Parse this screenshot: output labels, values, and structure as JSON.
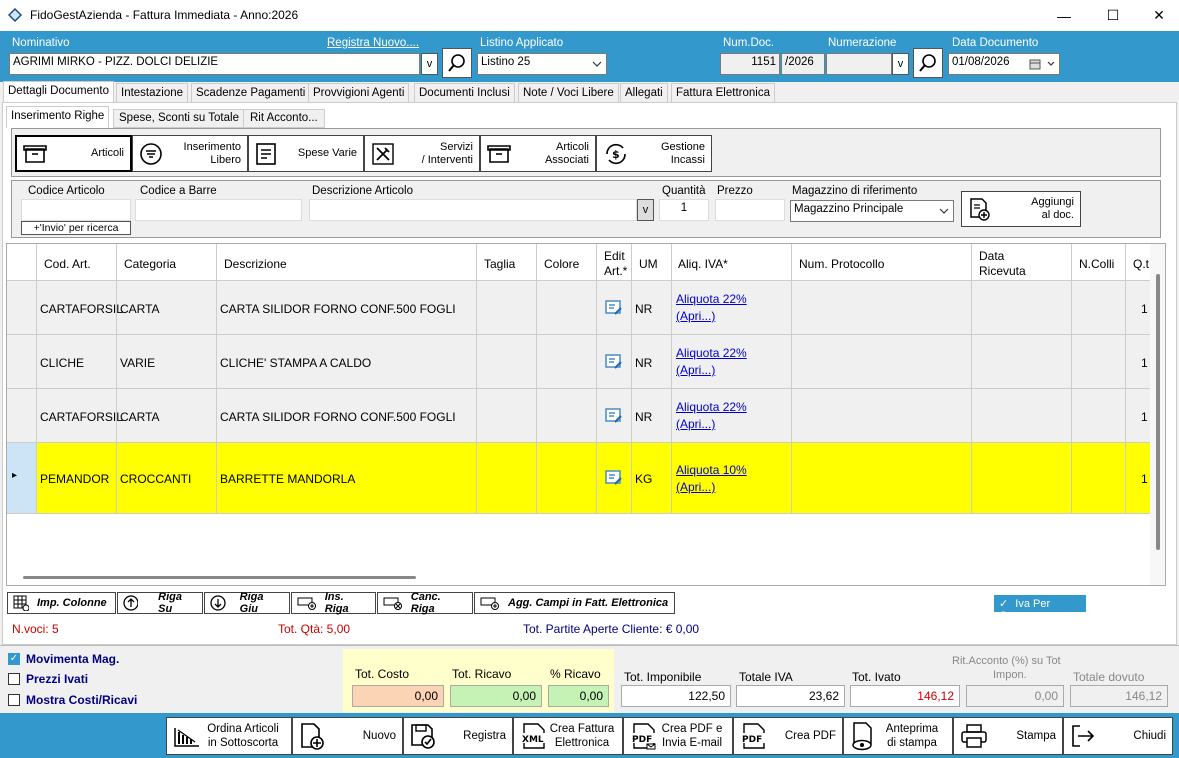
{
  "window": {
    "title": "FidoGestAzienda - Fattura Immediata - Anno:2026",
    "minimize": "—",
    "maximize": "☐",
    "close": "✕"
  },
  "header": {
    "nominativo_label": "Nominativo",
    "registra_link": "Registra Nuovo....",
    "nominativo_value": "AGRIMI MIRKO - PIZZ. DOLCI DELIZIE",
    "listino_label": "Listino Applicato",
    "listino_value": "Listino 25",
    "numdoc_label": "Num.Doc.",
    "numdoc_value": "1151",
    "numdoc_year": "/2026",
    "numerazione_label": "Numerazione",
    "numerazione_value": "",
    "data_label": "Data Documento",
    "data_value": "01/08/2026",
    "v": "v"
  },
  "tabs": [
    "Dettagli Documento",
    "Intestazione",
    "Scadenze Pagamenti",
    "Provvigioni Agenti",
    "Documenti Inclusi",
    "Note / Voci Libere",
    "Allegati",
    "Fattura Elettronica"
  ],
  "subtabs": [
    "Inserimento Righe",
    "Spese, Sconti su Totale",
    "Rit Acconto..."
  ],
  "toolbar": [
    {
      "l1": "Articoli",
      "l2": ""
    },
    {
      "l1": "Inserimento",
      "l2": "Libero"
    },
    {
      "l1": "Spese Varie",
      "l2": ""
    },
    {
      "l1": "Servizi",
      "l2": "/ Interventi"
    },
    {
      "l1": "Articoli",
      "l2": "Associati"
    },
    {
      "l1": "Gestione",
      "l2": "Incassi"
    }
  ],
  "entry": {
    "codice_label": "Codice Articolo",
    "codice_value": "",
    "invio_hint": "+'Invio' per ricerca",
    "barre_label": "Codice a Barre",
    "barre_value": "",
    "descr_label": "Descrizione Articolo",
    "descr_value": "",
    "qta_label": "Quantità",
    "qta_value": "1",
    "prezzo_label": "Prezzo",
    "prezzo_value": "",
    "mag_label": "Magazzino di riferimento",
    "mag_value": "Magazzino Principale",
    "aggiungi_l1": "Aggiungi",
    "aggiungi_l2": "al doc."
  },
  "grid": {
    "columns": {
      "cod": "Cod. Art.",
      "cat": "Categoria",
      "descr": "Descrizione",
      "taglia": "Taglia",
      "colore": "Colore",
      "edit1": "Edit",
      "edit2": "Art.*",
      "um": "UM",
      "iva": "Aliq. IVA*",
      "prot": "Num. Protocollo",
      "data1": "Data",
      "data2": "Ricevuta",
      "colli": "N.Colli",
      "qt": "Q.t"
    },
    "rows": [
      {
        "cod": "CARTAFORSIL",
        "cat": "CARTA",
        "descr": "CARTA SILIDOR FORNO CONF.500 FOGLI",
        "um": "NR",
        "iva1": "Aliquota 22% ",
        "iva2": "(Apri...)",
        "qt": "1"
      },
      {
        "cod": "CLICHE",
        "cat": "VARIE",
        "descr": "CLICHE' STAMPA A CALDO",
        "um": "NR",
        "iva1": "Aliquota 22% ",
        "iva2": "(Apri...)",
        "qt": "1"
      },
      {
        "cod": "CARTAFORSIL",
        "cat": "CARTA",
        "descr": "CARTA SILIDOR FORNO CONF.500 FOGLI",
        "um": "NR",
        "iva1": "Aliquota 22% ",
        "iva2": "(Apri...)",
        "qt": "1"
      },
      {
        "cod": "PEMANDOR",
        "cat": "CROCCANTI",
        "descr": "BARRETTE MANDORLA",
        "um": "KG",
        "iva1": "Aliquota 10% ",
        "iva2": "(Apri...)",
        "qt": "1"
      }
    ],
    "selected_marker": "▸"
  },
  "rowbuttons": [
    "Imp. Colonne",
    "Riga Su",
    "Riga Giu",
    "Ins. Riga",
    "Canc. Riga",
    "Agg. Campi in Fatt. Elettronica"
  ],
  "iva_cassa": "Iva Per Cassa",
  "status": {
    "nvoci": "N.voci: 5",
    "totqta": "Tot. Qtà: 5,00",
    "partite": "Tot. Partite Aperte Cliente: € 0,00"
  },
  "checks": {
    "movimenta": "Movimenta Mag.",
    "prezzi": "Prezzi Ivati",
    "mostra": "Mostra Costi/Ricavi"
  },
  "totals": {
    "costo_label": "Tot. Costo",
    "costo": "0,00",
    "ricavo_label": "Tot. Ricavo",
    "ricavo": "0,00",
    "pric_label": "% Ricavo",
    "pric": "0,00",
    "impon_label": "Tot. Imponibile",
    "impon": "122,50",
    "iva_label": "Totale IVA",
    "iva": "23,62",
    "ivato_label": "Tot. Ivato",
    "ivato": "146,12",
    "rit_label1": "Rit.Acconto (%) su Tot",
    "rit_label2": "Impon.",
    "rit": "0,00",
    "dovuto_label": "Totale dovuto",
    "dovuto": "146,12"
  },
  "bottom": [
    {
      "l1": "Ordina Articoli",
      "l2": "in Sottoscorta"
    },
    {
      "l1": "Nuovo",
      "l2": ""
    },
    {
      "l1": "Registra",
      "l2": ""
    },
    {
      "l1": "Crea Fattura",
      "l2": "Elettronica"
    },
    {
      "l1": "Crea PDF e",
      "l2": "Invia E-mail"
    },
    {
      "l1": "Crea PDF",
      "l2": ""
    },
    {
      "l1": "Anteprima",
      "l2": "di stampa"
    },
    {
      "l1": "Stampa",
      "l2": ""
    },
    {
      "l1": "Chiudi",
      "l2": ""
    }
  ],
  "colors": {
    "accent": "#3399cc",
    "selected_row": "#ffff00",
    "link": "#0000cc",
    "red": "#cc0000",
    "navy": "#000080"
  }
}
